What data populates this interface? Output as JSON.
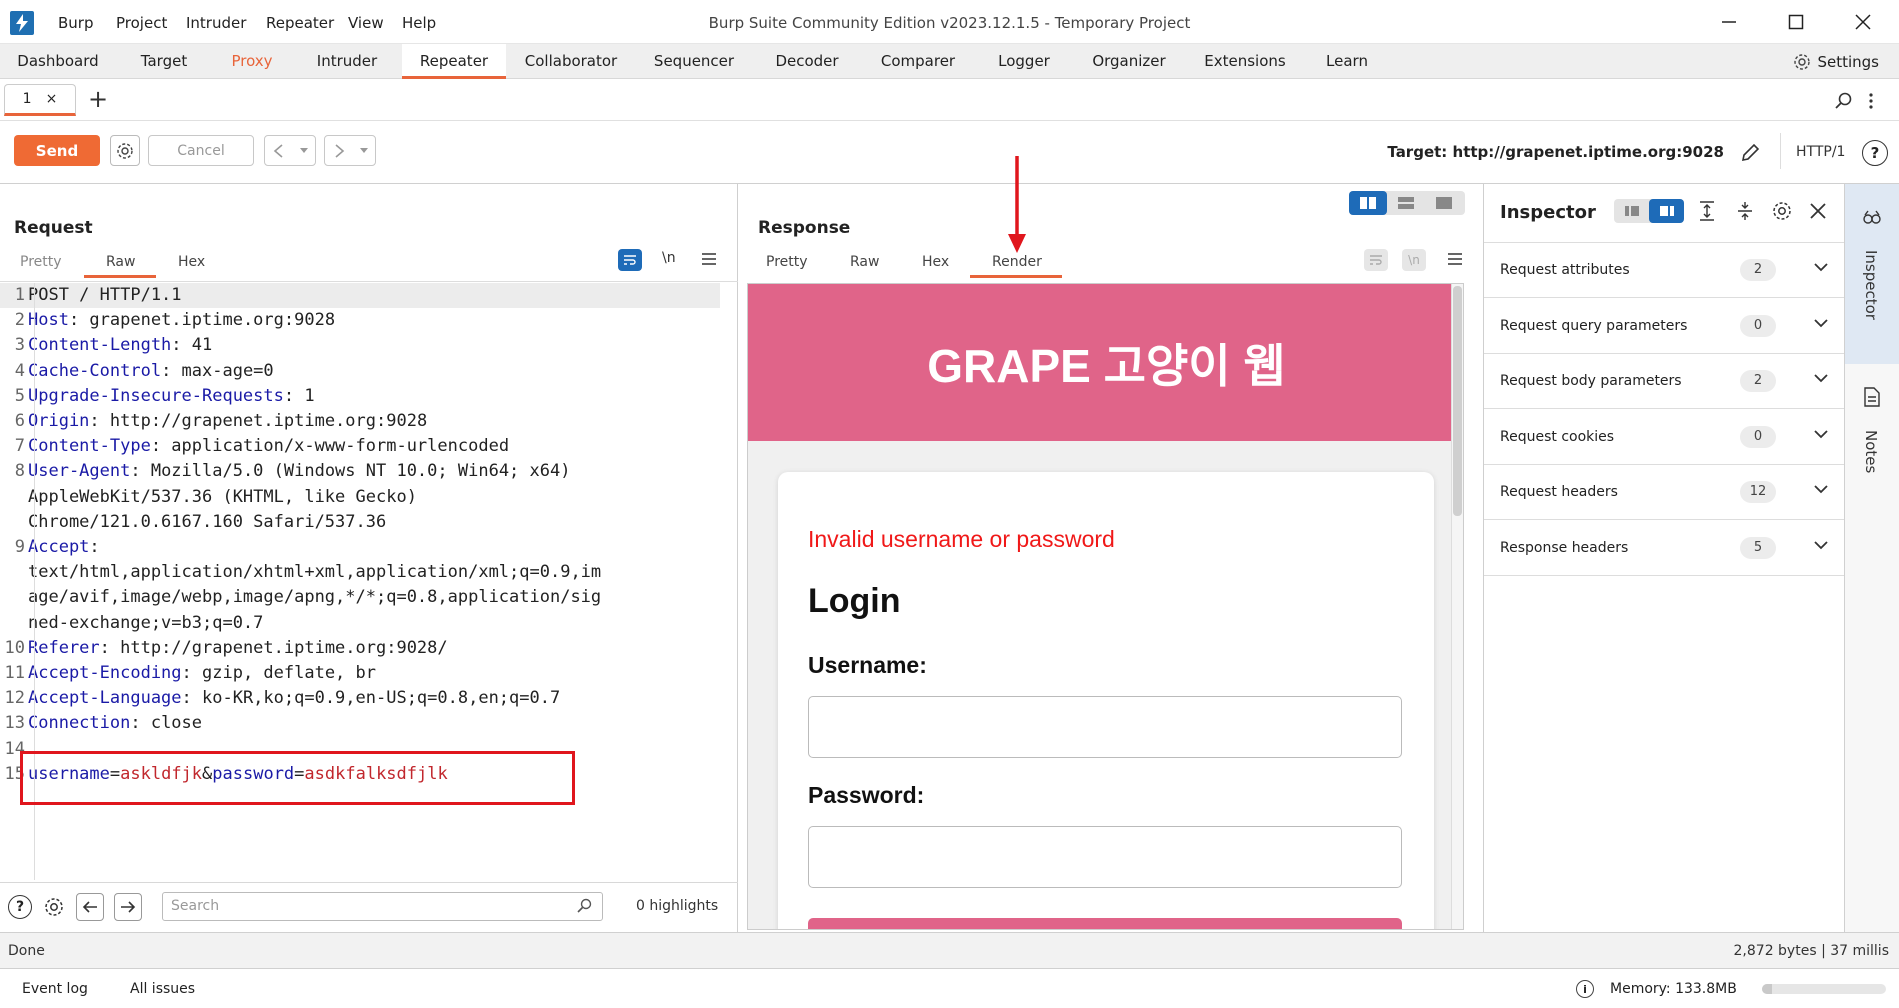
{
  "window": {
    "title": "Burp Suite Community Edition v2023.12.1.5 - Temporary Project",
    "menu": [
      "Burp",
      "Project",
      "Intruder",
      "Repeater",
      "View",
      "Help"
    ]
  },
  "main_tabs": [
    "Dashboard",
    "Target",
    "Proxy",
    "Intruder",
    "Repeater",
    "Collaborator",
    "Sequencer",
    "Decoder",
    "Comparer",
    "Logger",
    "Organizer",
    "Extensions",
    "Learn"
  ],
  "active_main_tab": "Repeater",
  "settings_label": "Settings",
  "repeater_tab": {
    "label": "1",
    "close": "×",
    "add": "+"
  },
  "toolbar": {
    "send": "Send",
    "cancel": "Cancel",
    "target_label": "Target: http://grapenet.iptime.org:9028",
    "http_version": "HTTP/1"
  },
  "request": {
    "title": "Request",
    "tabs": [
      "Pretty",
      "Raw",
      "Hex"
    ],
    "active_tab": "Raw",
    "newline_toggle": "\\n",
    "lines": [
      {
        "n": "1",
        "k": "POST / HTTP/1.1",
        "v": ""
      },
      {
        "n": "2",
        "k": "Host",
        "v": ": grapenet.iptime.org:9028"
      },
      {
        "n": "3",
        "k": "Content-Length",
        "v": ": 41"
      },
      {
        "n": "4",
        "k": "Cache-Control",
        "v": ": max-age=0"
      },
      {
        "n": "5",
        "k": "Upgrade-Insecure-Requests",
        "v": ": 1"
      },
      {
        "n": "6",
        "k": "Origin",
        "v": ": http://grapenet.iptime.org:9028"
      },
      {
        "n": "7",
        "k": "Content-Type",
        "v": ": application/x-www-form-urlencoded"
      },
      {
        "n": "8",
        "k": "User-Agent",
        "v": ": Mozilla/5.0 (Windows NT 10.0; Win64; x64)"
      },
      {
        "n": "",
        "k": "",
        "v": "AppleWebKit/537.36 (KHTML, like Gecko)"
      },
      {
        "n": "",
        "k": "",
        "v": "Chrome/121.0.6167.160 Safari/537.36"
      },
      {
        "n": "9",
        "k": "Accept",
        "v": ":"
      },
      {
        "n": "",
        "k": "",
        "v": "text/html,application/xhtml+xml,application/xml;q=0.9,im"
      },
      {
        "n": "",
        "k": "",
        "v": "age/avif,image/webp,image/apng,*/*;q=0.8,application/sig"
      },
      {
        "n": "",
        "k": "",
        "v": "ned-exchange;v=b3;q=0.7"
      },
      {
        "n": "10",
        "k": "Referer",
        "v": ": http://grapenet.iptime.org:9028/"
      },
      {
        "n": "11",
        "k": "Accept-Encoding",
        "v": ": gzip, deflate, br"
      },
      {
        "n": "12",
        "k": "Accept-Language",
        "v": ": ko-KR,ko;q=0.9,en-US;q=0.8,en;q=0.7"
      },
      {
        "n": "13",
        "k": "Connection",
        "v": ": close"
      },
      {
        "n": "14",
        "k": "",
        "v": ""
      }
    ],
    "body_line": {
      "n": "15",
      "k1": "username",
      "eq1": "=",
      "v1": "askldfjk",
      "amp": "&",
      "k2": "password",
      "eq2": "=",
      "v2": "asdkfalksdfjlk"
    },
    "search_placeholder": "Search",
    "highlights": "0 highlights"
  },
  "response": {
    "title": "Response",
    "tabs": [
      "Pretty",
      "Raw",
      "Hex",
      "Render"
    ],
    "active_tab": "Render",
    "render": {
      "header": "GRAPE 고양이 웹",
      "error": "Invalid username or password",
      "heading": "Login",
      "username_label": "Username:",
      "password_label": "Password:"
    }
  },
  "inspector": {
    "title": "Inspector",
    "rows": [
      {
        "label": "Request attributes",
        "count": "2"
      },
      {
        "label": "Request query parameters",
        "count": "0"
      },
      {
        "label": "Request body parameters",
        "count": "2"
      },
      {
        "label": "Request cookies",
        "count": "0"
      },
      {
        "label": "Request headers",
        "count": "12"
      },
      {
        "label": "Response headers",
        "count": "5"
      }
    ]
  },
  "side_tabs": [
    "Inspector",
    "Notes"
  ],
  "status": {
    "left": "Done",
    "right": "2,872 bytes | 37 millis"
  },
  "footer": {
    "event_log": "Event log",
    "all_issues": "All issues",
    "memory": "Memory: 133.8MB"
  },
  "colors": {
    "accent": "#e8643a",
    "send_button": "#ef6a34",
    "render_header": "#e06489",
    "annotation_red": "#e0161d",
    "header_key_blue": "#1a1aa6",
    "param_value_red": "#c1272d"
  }
}
